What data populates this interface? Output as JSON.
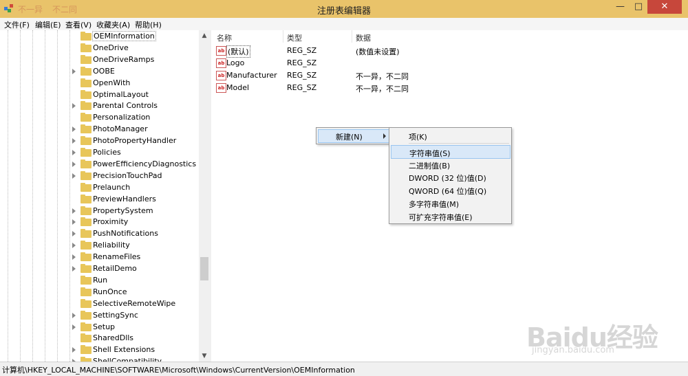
{
  "window": {
    "title": "注册表编辑器",
    "faint_tabs": [
      "不一异",
      "不二同"
    ]
  },
  "menu": [
    "文件(F)",
    "编辑(E)",
    "查看(V)",
    "收藏夹(A)",
    "帮助(H)"
  ],
  "tree": {
    "items": [
      {
        "label": "OEMInformation",
        "selected": true,
        "expandable": false
      },
      {
        "label": "OneDrive",
        "expandable": false
      },
      {
        "label": "OneDriveRamps",
        "expandable": false
      },
      {
        "label": "OOBE",
        "expandable": true
      },
      {
        "label": "OpenWith",
        "expandable": false
      },
      {
        "label": "OptimalLayout",
        "expandable": false
      },
      {
        "label": "Parental Controls",
        "expandable": true
      },
      {
        "label": "Personalization",
        "expandable": false
      },
      {
        "label": "PhotoManager",
        "expandable": true
      },
      {
        "label": "PhotoPropertyHandler",
        "expandable": true
      },
      {
        "label": "Policies",
        "expandable": true
      },
      {
        "label": "PowerEfficiencyDiagnostics",
        "expandable": true
      },
      {
        "label": "PrecisionTouchPad",
        "expandable": true
      },
      {
        "label": "Prelaunch",
        "expandable": false
      },
      {
        "label": "PreviewHandlers",
        "expandable": false
      },
      {
        "label": "PropertySystem",
        "expandable": true
      },
      {
        "label": "Proximity",
        "expandable": true
      },
      {
        "label": "PushNotifications",
        "expandable": true
      },
      {
        "label": "Reliability",
        "expandable": true
      },
      {
        "label": "RenameFiles",
        "expandable": true
      },
      {
        "label": "RetailDemo",
        "expandable": true
      },
      {
        "label": "Run",
        "expandable": false
      },
      {
        "label": "RunOnce",
        "expandable": false
      },
      {
        "label": "SelectiveRemoteWipe",
        "expandable": false
      },
      {
        "label": "SettingSync",
        "expandable": true
      },
      {
        "label": "Setup",
        "expandable": true
      },
      {
        "label": "SharedDlls",
        "expandable": false
      },
      {
        "label": "Shell Extensions",
        "expandable": true
      },
      {
        "label": "ShellCompatibility",
        "expandable": true
      }
    ]
  },
  "list": {
    "headers": {
      "name": "名称",
      "type": "类型",
      "data": "数据"
    },
    "rows": [
      {
        "name": "(默认)",
        "type": "REG_SZ",
        "data": "(数值未设置)",
        "focused": true
      },
      {
        "name": "Logo",
        "type": "REG_SZ",
        "data": ""
      },
      {
        "name": "Manufacturer",
        "type": "REG_SZ",
        "data": "不一异，不二同"
      },
      {
        "name": "Model",
        "type": "REG_SZ",
        "data": "不一异，不二同"
      }
    ]
  },
  "context_menu": {
    "new_label": "新建(N)",
    "submenu": {
      "key": "项(K)",
      "items": [
        {
          "label": "字符串值(S)",
          "highlighted": true
        },
        {
          "label": "二进制值(B)"
        },
        {
          "label": "DWORD (32 位)值(D)"
        },
        {
          "label": "QWORD (64 位)值(Q)"
        },
        {
          "label": "多字符串值(M)"
        },
        {
          "label": "可扩充字符串值(E)"
        }
      ]
    }
  },
  "status": "计算机\\HKEY_LOCAL_MACHINE\\SOFTWARE\\Microsoft\\Windows\\CurrentVersion\\OEMInformation",
  "watermark": {
    "big": "Baidu经验",
    "small": "jingyan.baidu.com"
  },
  "colors": {
    "titlebar": "#e9c36a",
    "close": "#c7473b",
    "highlight": "#d9e8f8"
  }
}
